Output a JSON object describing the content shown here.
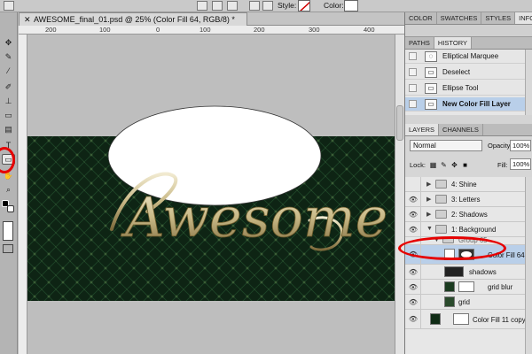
{
  "options_bar": {
    "style_label": "Style:",
    "color_label": "Color:",
    "swatch_color": "#ffffff"
  },
  "document": {
    "tab_close": "✕",
    "title": "AWESOME_final_01.psd @ 25% (Color Fill 64, RGB/8) *",
    "ruler_top": [
      "200",
      "100",
      "0",
      "100",
      "200",
      "300",
      "400"
    ],
    "canvas_text": "Awesome",
    "colors": {
      "pattern_dark": "#0e2414",
      "pattern_light": "#1a3d23",
      "ellipse_fill": "#ffffff",
      "lettering": "#e3d9a8"
    }
  },
  "panel": {
    "top_tabs": [
      "COLOR",
      "SWATCHES",
      "STYLES",
      "INFO"
    ],
    "history_tabs": [
      "PATHS",
      "HISTORY"
    ],
    "history_items": [
      {
        "label": "Elliptical Marquee",
        "icon": "ellipse-marquee-icon",
        "glyph": "◌"
      },
      {
        "label": "Deselect",
        "icon": "history-state-icon",
        "glyph": "▭"
      },
      {
        "label": "Ellipse Tool",
        "icon": "history-state-icon",
        "glyph": "▭"
      },
      {
        "label": "New Color Fill Layer",
        "icon": "history-state-icon",
        "glyph": "▭",
        "active": true
      }
    ],
    "layers_tabs": [
      "LAYERS",
      "CHANNELS"
    ],
    "blend_mode": "Normal",
    "opacity_label": "Opacity:",
    "opacity_value": "100%",
    "lock_label": "Lock:",
    "fill_label": "Fill:",
    "fill_value": "100%",
    "layers": [
      {
        "name": "4: Shine"
      },
      {
        "name": "3: Letters"
      },
      {
        "name": "2: Shadows"
      },
      {
        "name": "1: Background"
      },
      {
        "name": "Group 65"
      },
      {
        "name": "Color Fill 64"
      },
      {
        "name": "shadows"
      },
      {
        "name": "grid blur"
      },
      {
        "name": "grid"
      },
      {
        "name": "Color Fill 11 copy 2"
      }
    ]
  }
}
